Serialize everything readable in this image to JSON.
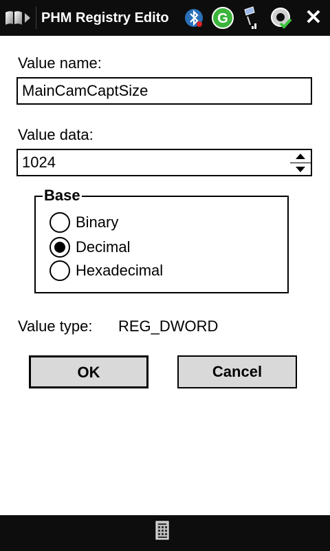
{
  "titlebar": {
    "title": "PHM Registry Edito",
    "close_label": "✕"
  },
  "form": {
    "value_name_label": "Value name:",
    "value_name": "MainCamCaptSize",
    "value_data_label": "Value data:",
    "value_data": "1024",
    "base": {
      "title": "Base",
      "options": [
        {
          "label": "Binary",
          "selected": false
        },
        {
          "label": "Decimal",
          "selected": true
        },
        {
          "label": "Hexadecimal",
          "selected": false
        }
      ]
    },
    "value_type_label": "Value type:",
    "value_type": "REG_DWORD"
  },
  "buttons": {
    "ok_label": "OK",
    "cancel_label": "Cancel"
  },
  "icons": {
    "start": "windows-start-icon",
    "tray": [
      "bluetooth-icon",
      "g-app-icon",
      "signal-icon",
      "sync-check-icon"
    ],
    "keyboard": "keyboard-icon"
  },
  "colors": {
    "bar_bg": "#0d0d0d",
    "button_bg": "#d9d9d9",
    "g_icon_green": "#3cb43c"
  }
}
